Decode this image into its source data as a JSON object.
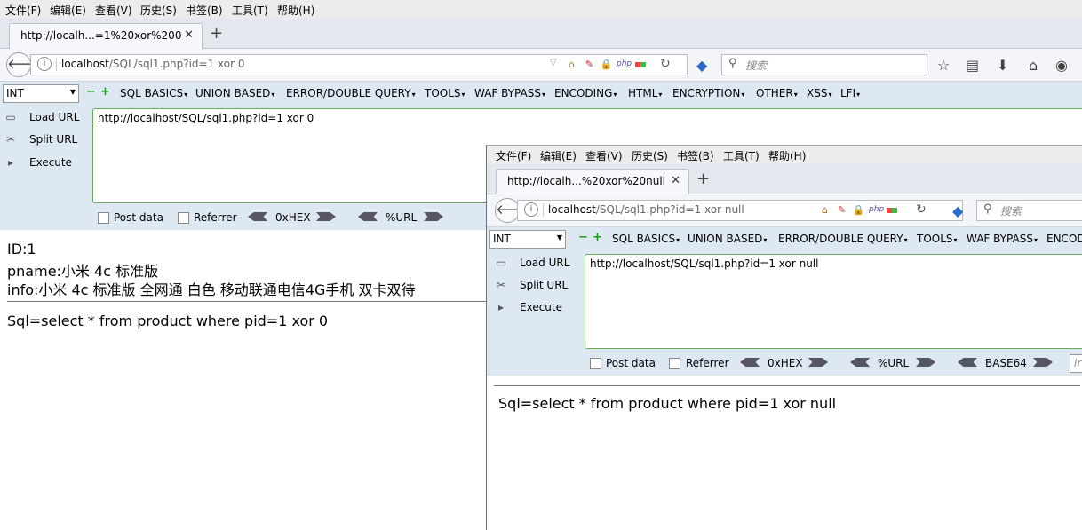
{
  "menu": [
    "文件(F)",
    "编辑(E)",
    "查看(V)",
    "历史(S)",
    "书签(B)",
    "工具(T)",
    "帮助(H)"
  ],
  "back_window": {
    "tab_title": "http://localh...=1%20xor%200",
    "url_host": "localhost",
    "url_path": "/SQL/sql1.php?id=1 xor 0",
    "search_placeholder": "搜索",
    "hackbar_text": "http://localhost/SQL/sql1.php?id=1 xor 0",
    "id_line": "ID:1",
    "pname_line": "pname:小米 4c 标准版",
    "info_line": "info:小米 4c 标准版 全网通 白色 移动联通电信4G手机 双卡双待",
    "sql_line": "Sql=select * from product where pid=1 xor 0"
  },
  "front_window": {
    "tab_title": "http://localh...%20xor%20null",
    "url_host": "localhost",
    "url_path": "/SQL/sql1.php?id=1 xor null",
    "search_placeholder": "搜索",
    "hackbar_text": "http://localhost/SQL/sql1.php?id=1 xor null",
    "sql_line": "Sql=select * from product where pid=1 xor null"
  },
  "hackbar": {
    "select_value": "INT",
    "menus": [
      "SQL BASICS",
      "UNION BASED",
      "ERROR/DOUBLE QUERY",
      "TOOLS",
      "WAF BYPASS",
      "ENCODING",
      "HTML",
      "ENCRYPTION",
      "OTHER",
      "XSS",
      "LFI"
    ],
    "menus_front": [
      "SQL BASICS",
      "UNION BASED",
      "ERROR/DOUBLE QUERY",
      "TOOLS",
      "WAF BYPASS",
      "ENCOD"
    ],
    "load_url": "Load URL",
    "split_url": "Split URL",
    "execute": "Execute",
    "post_data": "Post data",
    "referrer": "Referrer",
    "hex": "0xHEX",
    "url_enc": "%URL",
    "base64": "BASE64",
    "front_input_stub": "Ir"
  },
  "colors": {
    "hackbar_bg": "#dee8f2",
    "textarea_border": "#6aaa5a",
    "tab_strip": "#e4e8ee"
  }
}
